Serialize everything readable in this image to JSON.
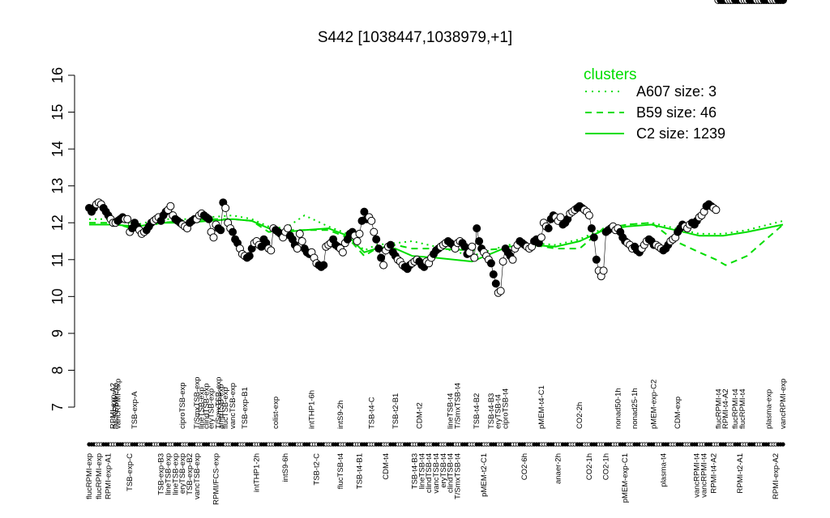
{
  "chart_data": {
    "type": "line",
    "title": "S442 [1038447,1038979,+1]",
    "xlabel": "",
    "ylabel": "",
    "ylim": [
      7,
      16
    ],
    "yticks": [
      "7",
      "8",
      "9",
      "10",
      "11",
      "12",
      "13",
      "14",
      "15",
      "16"
    ],
    "grid": false,
    "legend": {
      "position": "top-right",
      "title": "clusters",
      "entries": [
        {
          "label": "A607 size: 3",
          "style": "dotted"
        },
        {
          "label": "B59 size: 46",
          "style": "dashed"
        },
        {
          "label": "C2 size: 1239",
          "style": "solid"
        }
      ]
    },
    "colors": {
      "series": "#00dd00",
      "points": "#000000",
      "background": "#ffffff"
    },
    "top_labels": [
      {
        "text": "RPMI-exp-A2",
        "x": 10
      },
      {
        "text": "flucRPMI-exp",
        "x": 11
      },
      {
        "text": "vancRPMI-exp",
        "x": 12
      },
      {
        "text": "TSB-exp-A",
        "x": 19
      },
      {
        "text": "ciproTSB-exp",
        "x": 39
      },
      {
        "text": "T/SmxTSB-exp",
        "x": 45
      },
      {
        "text": "lineTSB-exp",
        "x": 47
      },
      {
        "text": "clindTSB-exp",
        "x": 49
      },
      {
        "text": "eryTSB-exp",
        "x": 51
      },
      {
        "text": "T/SmxTSB-exp",
        "x": 54
      },
      {
        "text": "ampTSB-exp",
        "x": 55
      },
      {
        "text": "flucTSB-exp",
        "x": 57
      },
      {
        "text": "vancTSB-exp",
        "x": 60
      },
      {
        "text": "TSB-exp-B1",
        "x": 65
      },
      {
        "text": "colist-exp",
        "x": 78
      },
      {
        "text": "intTHP1-6h",
        "x": 93
      },
      {
        "text": "intS9-2h",
        "x": 105
      },
      {
        "text": "TSB-t4-C",
        "x": 118
      },
      {
        "text": "TSB-t2-B1",
        "x": 128
      },
      {
        "text": "CDM-t2",
        "x": 138
      },
      {
        "text": "lineTSB-t4",
        "x": 151
      },
      {
        "text": "T/SmxTSB-t4",
        "x": 154
      },
      {
        "text": "TSB-t4-B2",
        "x": 162
      },
      {
        "text": "TSB-t4-B3",
        "x": 168
      },
      {
        "text": "eryTSB-t4",
        "x": 171
      },
      {
        "text": "ciproTSB-t4",
        "x": 174
      },
      {
        "text": "pMEM-t4-C1",
        "x": 189
      },
      {
        "text": "CO2-2h",
        "x": 205
      },
      {
        "text": "nonad50-1h",
        "x": 221
      },
      {
        "text": "nonad25-1h",
        "x": 228
      },
      {
        "text": "pMEM-exp-C2",
        "x": 236
      },
      {
        "text": "CDM-exp",
        "x": 246
      },
      {
        "text": "flucRPMI-t4",
        "x": 263
      },
      {
        "text": "RPMI-t4-A2",
        "x": 266
      },
      {
        "text": "flucRPMI-t4",
        "x": 270
      },
      {
        "text": "flucRPMI-t4",
        "x": 273
      },
      {
        "text": "plasma-exp",
        "x": 284
      },
      {
        "text": "vancRPMI-exp",
        "x": 290
      }
    ],
    "bottom_labels": [
      {
        "text": "flucRPMI-exp",
        "x": 0
      },
      {
        "text": "flucRPMI-exp",
        "x": 4
      },
      {
        "text": "RPMI-exp-A1",
        "x": 8
      },
      {
        "text": "TSB-exp-C",
        "x": 17
      },
      {
        "text": "TSB-exp-B3",
        "x": 30
      },
      {
        "text": "lineTSB-exp",
        "x": 33
      },
      {
        "text": "lineTSB-exp",
        "x": 36
      },
      {
        "text": "eryTSB-exp",
        "x": 39
      },
      {
        "text": "TSB-exp-B2",
        "x": 42
      },
      {
        "text": "vancTSB-exp",
        "x": 45
      },
      {
        "text": "RPMI/FCS-exp",
        "x": 53
      },
      {
        "text": "intTHP1-2h",
        "x": 70
      },
      {
        "text": "intS9-6h",
        "x": 82
      },
      {
        "text": "TSB-t2-C",
        "x": 95
      },
      {
        "text": "flucTSB-t4",
        "x": 105
      },
      {
        "text": "TSB-t4-B1",
        "x": 113
      },
      {
        "text": "CDM-t4",
        "x": 124
      },
      {
        "text": "TSB-t4-B3",
        "x": 136
      },
      {
        "text": "lineTSB-t4",
        "x": 139
      },
      {
        "text": "clindTSB-t4",
        "x": 142
      },
      {
        "text": "vancTSB-t4",
        "x": 145
      },
      {
        "text": "eryTSB-t4",
        "x": 148
      },
      {
        "text": "clindTSB-t4",
        "x": 151
      },
      {
        "text": "T/SmxTSB-t4",
        "x": 154
      },
      {
        "text": "pMEM-t2-C1",
        "x": 165
      },
      {
        "text": "CO2-6h",
        "x": 182
      },
      {
        "text": "anaer-2h",
        "x": 196
      },
      {
        "text": "CO2-1h",
        "x": 209
      },
      {
        "text": "CO2-1h",
        "x": 216
      },
      {
        "text": "pMEM-exp-C1",
        "x": 224
      },
      {
        "text": "plasma-t4",
        "x": 240
      },
      {
        "text": "vancRPMI-t4",
        "x": 254
      },
      {
        "text": "vancRPMI-t4",
        "x": 257
      },
      {
        "text": "RPMI-t4-A2",
        "x": 261
      },
      {
        "text": "RPMI-t2-A1",
        "x": 272
      },
      {
        "text": "RPMI-exp-A2",
        "x": 287
      }
    ],
    "series": [
      {
        "name": "C2 size: 1239",
        "style": "solid",
        "x": [
          0,
          10,
          20,
          30,
          40,
          50,
          60,
          68,
          75,
          82,
          90,
          100,
          108,
          115,
          120,
          128,
          135,
          145,
          160,
          175,
          185,
          195,
          205,
          215,
          225,
          235,
          245,
          255,
          265,
          275,
          290
        ],
        "values": [
          11.95,
          11.95,
          11.9,
          12.0,
          12.0,
          12.05,
          12.1,
          12.05,
          11.85,
          11.75,
          11.8,
          11.85,
          11.65,
          11.2,
          11.3,
          11.3,
          11.1,
          11.05,
          10.95,
          11.35,
          11.4,
          11.35,
          11.5,
          11.8,
          11.9,
          11.95,
          11.8,
          11.65,
          11.65,
          11.75,
          11.95
        ]
      },
      {
        "name": "B59 size: 46",
        "style": "dashed",
        "x": [
          0,
          10,
          20,
          30,
          40,
          50,
          60,
          68,
          75,
          82,
          90,
          100,
          108,
          115,
          120,
          128,
          135,
          145,
          160,
          175,
          185,
          195,
          205,
          215,
          225,
          235,
          245,
          255,
          262,
          266,
          275,
          290
        ],
        "values": [
          12.0,
          12.0,
          11.8,
          12.0,
          12.05,
          12.1,
          12.1,
          12.05,
          11.75,
          11.8,
          11.8,
          11.8,
          11.6,
          11.1,
          11.3,
          11.4,
          11.3,
          11.3,
          11.25,
          11.3,
          11.4,
          11.3,
          11.3,
          11.85,
          11.95,
          12.0,
          11.5,
          11.2,
          11.0,
          10.85,
          11.1,
          11.95
        ]
      },
      {
        "name": "A607 size: 3",
        "style": "dotted",
        "x": [
          0,
          10,
          20,
          30,
          40,
          50,
          60,
          68,
          75,
          82,
          90,
          100,
          108,
          115,
          120,
          128,
          135,
          145,
          160,
          175,
          185,
          195,
          205,
          215,
          225,
          235,
          245,
          255,
          265,
          275,
          290
        ],
        "values": [
          12.1,
          12.1,
          11.95,
          12.1,
          12.1,
          12.15,
          12.2,
          12.1,
          11.9,
          11.85,
          12.2,
          11.9,
          11.7,
          11.25,
          11.4,
          11.45,
          11.5,
          11.35,
          11.1,
          11.4,
          11.45,
          11.4,
          11.55,
          11.85,
          11.95,
          12.0,
          11.85,
          11.7,
          11.7,
          11.8,
          12.05
        ]
      }
    ],
    "points": {
      "x": [
        0,
        1,
        2,
        3,
        4,
        5,
        6,
        7,
        8,
        9,
        10,
        11,
        12,
        13,
        14,
        15,
        16,
        17,
        18,
        19,
        20,
        21,
        22,
        23,
        24,
        25,
        26,
        27,
        28,
        29,
        30,
        31,
        32,
        33,
        34,
        35,
        36,
        37,
        38,
        39,
        40,
        41,
        42,
        43,
        44,
        45,
        46,
        47,
        48,
        49,
        50,
        51,
        52,
        53,
        54,
        55,
        56,
        57,
        58,
        59,
        60,
        61,
        62,
        63,
        64,
        65,
        66,
        67,
        68,
        69,
        70,
        71,
        72,
        73,
        74,
        75,
        76,
        77,
        78,
        79,
        80,
        81,
        82,
        83,
        84,
        85,
        86,
        87,
        88,
        89,
        90,
        91,
        92,
        93,
        94,
        95,
        96,
        97,
        98,
        99,
        100,
        101,
        102,
        103,
        104,
        105,
        106,
        107,
        108,
        109,
        110,
        111,
        112,
        113,
        114,
        115,
        116,
        117,
        118,
        119,
        120,
        121,
        122,
        123,
        124,
        125,
        126,
        127,
        128,
        129,
        130,
        131,
        132,
        133,
        134,
        135,
        136,
        137,
        138,
        139,
        140,
        141,
        142,
        143,
        144,
        145,
        146,
        147,
        148,
        149,
        150,
        151,
        152,
        153,
        154,
        155,
        156,
        157,
        158,
        159,
        160,
        161,
        162,
        163,
        164,
        165,
        166,
        167,
        168,
        169,
        170,
        171,
        172,
        173,
        174,
        175,
        176,
        177,
        178,
        179,
        180,
        181,
        182,
        183,
        184,
        185,
        186,
        187,
        188,
        189,
        190,
        191,
        192,
        193,
        194,
        195,
        196,
        197,
        198,
        199,
        200,
        201,
        202,
        203,
        204,
        205,
        206,
        207,
        208,
        209,
        210,
        211,
        212,
        213,
        214,
        215,
        216,
        217,
        218,
        219,
        220,
        221,
        222,
        223,
        224,
        225,
        226,
        227,
        228,
        229,
        230,
        231,
        232,
        233,
        234,
        235,
        236,
        237,
        238,
        239,
        240,
        241,
        242,
        243,
        244,
        245,
        246,
        247,
        248,
        249,
        250,
        251,
        252,
        253,
        254,
        255,
        256,
        257,
        258,
        259,
        260,
        261,
        262,
        263,
        264,
        265,
        266,
        267,
        268,
        269,
        270,
        271,
        272,
        273,
        274,
        275,
        276,
        277,
        278,
        279,
        280,
        281,
        282,
        283,
        284,
        285,
        286,
        287,
        288,
        289,
        290
      ],
      "values": [
        12.4,
        12.3,
        12.4,
        12.5,
        12.55,
        12.5,
        12.4,
        12.3,
        12.2,
        12.1,
        12.0,
        12.0,
        12.05,
        12.1,
        12.15,
        12.1,
        12.1,
        11.75,
        11.85,
        12.0,
        11.9,
        11.8,
        11.7,
        11.75,
        11.8,
        11.9,
        12.0,
        12.05,
        12.1,
        12.15,
        12.05,
        12.2,
        12.3,
        12.35,
        12.45,
        12.2,
        12.1,
        12.05,
        12.0,
        11.95,
        11.9,
        11.85,
        12.0,
        12.05,
        12.1,
        12.1,
        12.2,
        12.25,
        12.2,
        12.15,
        12.1,
        11.75,
        11.6,
        11.95,
        11.85,
        11.8,
        12.55,
        12.4,
        12.0,
        11.85,
        11.75,
        11.55,
        11.45,
        11.3,
        11.15,
        11.1,
        11.05,
        11.1,
        11.3,
        11.45,
        11.5,
        11.4,
        11.35,
        11.55,
        11.45,
        11.3,
        11.25,
        11.85,
        11.8,
        11.75,
        11.7,
        11.6,
        11.75,
        11.85,
        11.65,
        11.55,
        11.4,
        11.3,
        11.7,
        11.5,
        11.3,
        11.2,
        11.15,
        11.2,
        11.05,
        10.9,
        10.85,
        10.8,
        10.85,
        11.35,
        11.4,
        11.45,
        11.55,
        11.4,
        11.35,
        11.3,
        11.2,
        11.45,
        11.55,
        11.7,
        11.75,
        11.65,
        11.5,
        11.7,
        12.05,
        12.3,
        12.1,
        12.15,
        12.05,
        11.75,
        11.55,
        11.3,
        11.05,
        10.85,
        11.25,
        11.35,
        11.4,
        11.2,
        11.1,
        11.0,
        10.95,
        10.85,
        10.8,
        10.75,
        10.85,
        10.9,
        10.95,
        11.0,
        10.95,
        10.85,
        10.8,
        10.95,
        10.9,
        11.05,
        11.15,
        11.25,
        11.3,
        11.35,
        11.4,
        11.45,
        11.5,
        11.45,
        11.4,
        11.3,
        11.45,
        11.5,
        11.45,
        11.35,
        11.15,
        11.2,
        11.35,
        11.05,
        11.85,
        11.5,
        11.3,
        11.2,
        11.1,
        11.0,
        10.9,
        10.6,
        10.35,
        10.1,
        10.15,
        10.95,
        11.3,
        11.2,
        11.1,
        11.0,
        11.3,
        11.4,
        11.5,
        11.45,
        11.4,
        11.35,
        11.3,
        11.35,
        11.5,
        11.55,
        11.45,
        11.6,
        12.0,
        11.9,
        11.85,
        12.1,
        12.2,
        12.15,
        12.05,
        12.15,
        11.95,
        12.0,
        12.1,
        12.25,
        12.3,
        12.35,
        12.4,
        12.45,
        12.4,
        12.35,
        12.3,
        12.2,
        11.85,
        11.6,
        11.0,
        10.7,
        10.55,
        10.7,
        11.75,
        11.8,
        11.85,
        11.9,
        11.8,
        11.85,
        11.75,
        11.6,
        11.5,
        11.45,
        11.4,
        11.3,
        11.35,
        11.25,
        11.2,
        11.3,
        11.4,
        11.5,
        11.55,
        11.5,
        11.4,
        11.4,
        11.35,
        11.3,
        11.25,
        11.3,
        11.4,
        11.5,
        11.55,
        11.6,
        11.75,
        11.85,
        11.95,
        11.9,
        11.85,
        11.95,
        12.0,
        11.95,
        12.05,
        12.15,
        12.2,
        12.3,
        12.45,
        12.5,
        12.45,
        12.4,
        12.35
      ]
    }
  }
}
